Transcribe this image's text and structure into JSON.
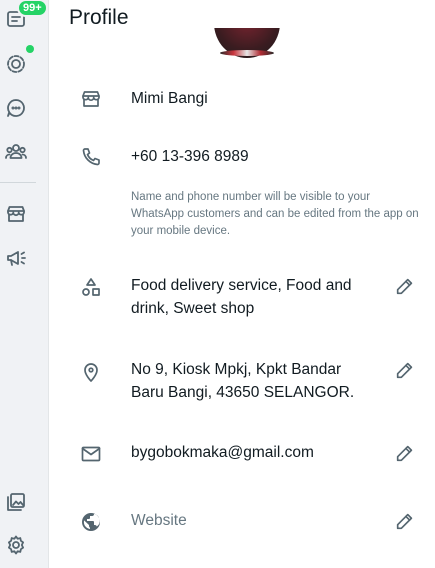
{
  "rail": {
    "chats_badge": "99+",
    "icons": [
      "chats-icon",
      "status-icon",
      "channels-icon",
      "communities-icon",
      "catalog-icon",
      "advertise-icon",
      "media-icon",
      "settings-icon"
    ]
  },
  "profile": {
    "title": "Profile",
    "business_name": "Mimi Bangi",
    "phone": "+60 13-396 8989",
    "hint": "Name and phone number will be visible to your WhatsApp customers and can be edited from the app on your mobile device.",
    "category": "Food delivery service, Food and drink, Sweet shop",
    "address": "No 9, Kiosk Mpkj, Kpkt Bandar Baru Bangi, 43650 SELANGOR.",
    "email": "bygobokmaka@gmail.com",
    "website_placeholder": "Website"
  },
  "colors": {
    "accent": "#25d366",
    "icon": "#54656f",
    "muted_text": "#667781",
    "rail_bg": "#f0f2f5"
  }
}
